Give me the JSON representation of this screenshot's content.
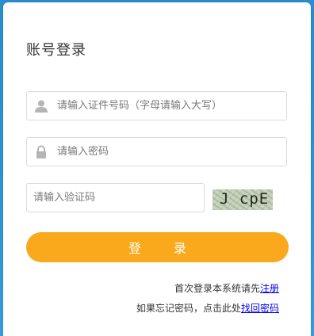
{
  "login": {
    "title": "账号登录",
    "id_field": {
      "placeholder": "请输入证件号码（字母请输入大写）",
      "value": ""
    },
    "password_field": {
      "placeholder": "请输入密码",
      "value": ""
    },
    "captcha_field": {
      "placeholder": "请输入验证码",
      "value": ""
    },
    "captcha_image_text": "J cpE",
    "login_button_label": "登 录",
    "first_login_text": "首次登录本系统请先",
    "register_link": "注册",
    "forgot_text": "如果忘记密码，点击此处",
    "recover_link": "找回密码"
  },
  "colors": {
    "background": "#2f95d4",
    "button": "#f9a91b",
    "link": "#0000ee"
  },
  "icons": {
    "id_field": "user-icon",
    "password_field": "lock-icon"
  }
}
